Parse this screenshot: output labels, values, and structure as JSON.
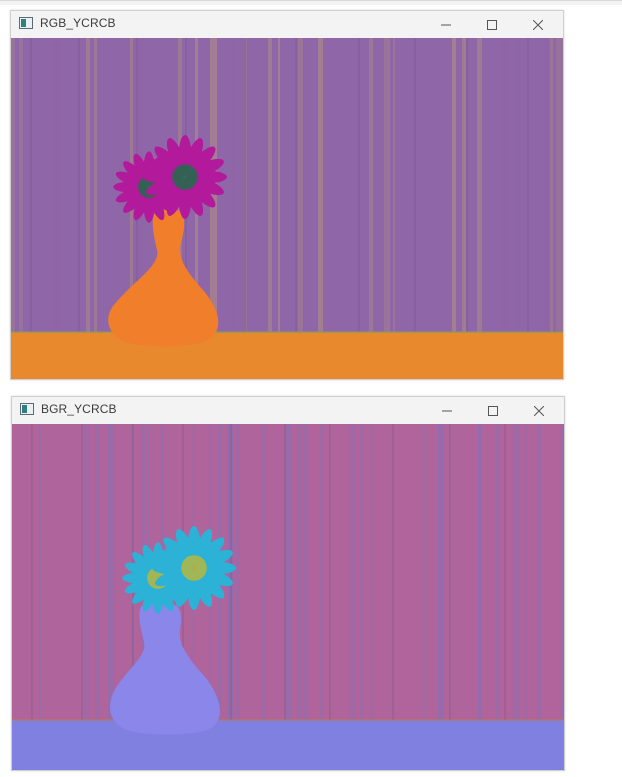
{
  "windows": [
    {
      "title": "RGB_YCRCB",
      "controls": [
        "minimize-icon",
        "maximize-icon",
        "close-icon"
      ],
      "image_colors": {
        "wall": "#8f66a8",
        "wall_light": "#a9868a",
        "floor": "#e8892e",
        "vase": "#f07e2a",
        "flower": "#b3199b",
        "flower_center": "#1f6d49"
      }
    },
    {
      "title": "BGR_YCRCB",
      "controls": [
        "minimize-icon",
        "maximize-icon",
        "close-icon"
      ],
      "image_colors": {
        "wall": "#b0649c",
        "wall_light": "#8f6db0",
        "floor": "#7f80df",
        "vase": "#8b86ea",
        "flower": "#2bb2d6",
        "flower_center": "#b6b63e"
      }
    }
  ]
}
